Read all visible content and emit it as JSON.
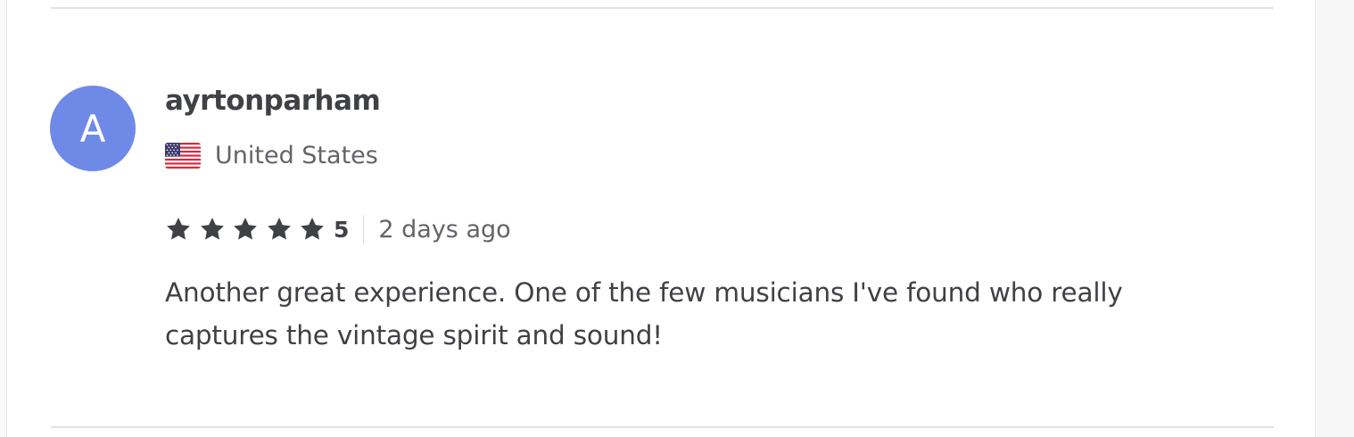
{
  "review": {
    "avatar_initial": "A",
    "username": "ayrtonparham",
    "country": "United States",
    "flag_icon": "us-flag-icon",
    "rating_value": "5",
    "stars": 5,
    "star_icon": "star-icon",
    "time_ago": "2 days ago",
    "text": "Another great experience. One of the few musicians I've found who really captures the vintage spirit and sound!"
  },
  "colors": {
    "avatar_bg": "#6f8ae6",
    "text_dark": "#404145",
    "text_muted": "#62646a",
    "divider": "#e2e2e2"
  }
}
